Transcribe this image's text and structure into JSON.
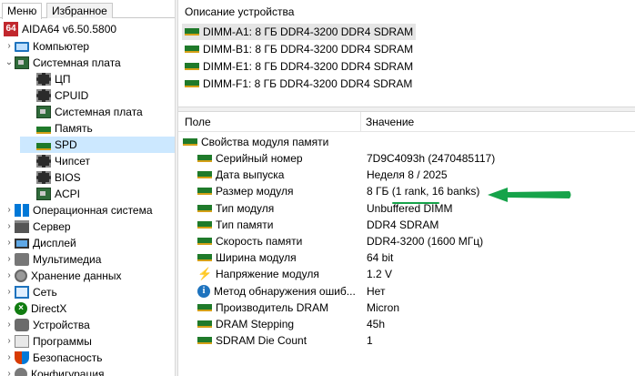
{
  "tabs": {
    "menu": "Меню",
    "favorites": "Избранное"
  },
  "app": {
    "title": "AIDA64 v6.50.5800",
    "logo_text": "64"
  },
  "tree": [
    {
      "label": "Компьютер",
      "icon": "computer-icon",
      "expander": "›"
    },
    {
      "label": "Системная плата",
      "icon": "motherboard-icon",
      "expander": "⌄"
    },
    {
      "label": "ЦП",
      "icon": "cpu-icon"
    },
    {
      "label": "CPUID",
      "icon": "cpuid-icon"
    },
    {
      "label": "Системная плата",
      "icon": "board-icon"
    },
    {
      "label": "Память",
      "icon": "memory-icon"
    },
    {
      "label": "SPD",
      "icon": "spd-icon",
      "selected": true
    },
    {
      "label": "Чипсет",
      "icon": "chipset-icon"
    },
    {
      "label": "BIOS",
      "icon": "bios-icon"
    },
    {
      "label": "ACPI",
      "icon": "acpi-icon"
    },
    {
      "label": "Операционная система",
      "icon": "windows-icon",
      "expander": "›"
    },
    {
      "label": "Сервер",
      "icon": "server-icon",
      "expander": "›"
    },
    {
      "label": "Дисплей",
      "icon": "display-icon",
      "expander": "›"
    },
    {
      "label": "Мультимедиа",
      "icon": "multimedia-icon",
      "expander": "›"
    },
    {
      "label": "Хранение данных",
      "icon": "storage-icon",
      "expander": "›"
    },
    {
      "label": "Сеть",
      "icon": "network-icon",
      "expander": "›"
    },
    {
      "label": "DirectX",
      "icon": "directx-icon",
      "expander": "›"
    },
    {
      "label": "Устройства",
      "icon": "devices-icon",
      "expander": "›"
    },
    {
      "label": "Программы",
      "icon": "programs-icon",
      "expander": "›"
    },
    {
      "label": "Безопасность",
      "icon": "security-icon",
      "expander": "›"
    },
    {
      "label": "Конфигурация",
      "icon": "config-icon",
      "expander": "›"
    }
  ],
  "devices": {
    "header": "Описание устройства",
    "items": [
      "DIMM-A1: 8 ГБ DDR4-3200 DDR4 SDRAM",
      "DIMM-B1: 8 ГБ DDR4-3200 DDR4 SDRAM",
      "DIMM-E1: 8 ГБ DDR4-3200 DDR4 SDRAM",
      "DIMM-F1: 8 ГБ DDR4-3200 DDR4 SDRAM"
    ]
  },
  "columns": {
    "field": "Поле",
    "value": "Значение"
  },
  "group": {
    "label": "Свойства модуля памяти"
  },
  "properties": [
    {
      "field": "Серийный номер",
      "value": "7D9C4093h (2470485117)",
      "icon": "ram-icon"
    },
    {
      "field": "Дата выпуска",
      "value": "Неделя 8 / 2025",
      "icon": "ram-icon"
    },
    {
      "field": "Размер модуля",
      "value": "8 ГБ (1 rank, 16 banks)",
      "icon": "ram-icon"
    },
    {
      "field": "Тип модуля",
      "value": "Unbuffered DIMM",
      "icon": "ram-icon"
    },
    {
      "field": "Тип памяти",
      "value": "DDR4 SDRAM",
      "icon": "ram-icon"
    },
    {
      "field": "Скорость памяти",
      "value": "DDR4-3200 (1600 МГц)",
      "icon": "ram-icon"
    },
    {
      "field": "Ширина модуля",
      "value": "64 bit",
      "icon": "ram-icon"
    },
    {
      "field": "Напряжение модуля",
      "value": "1.2 V",
      "icon": "voltage-icon"
    },
    {
      "field": "Метод обнаружения ошиб...",
      "value": "Нет",
      "icon": "info-icon"
    },
    {
      "field": "Производитель DRAM",
      "value": "Micron",
      "icon": "ram-icon"
    },
    {
      "field": "DRAM Stepping",
      "value": "45h",
      "icon": "ram-icon"
    },
    {
      "field": "SDRAM Die Count",
      "value": "1",
      "icon": "ram-icon"
    }
  ],
  "annotation": {
    "color": "#16a34a",
    "icon": "arrow-left-icon"
  }
}
